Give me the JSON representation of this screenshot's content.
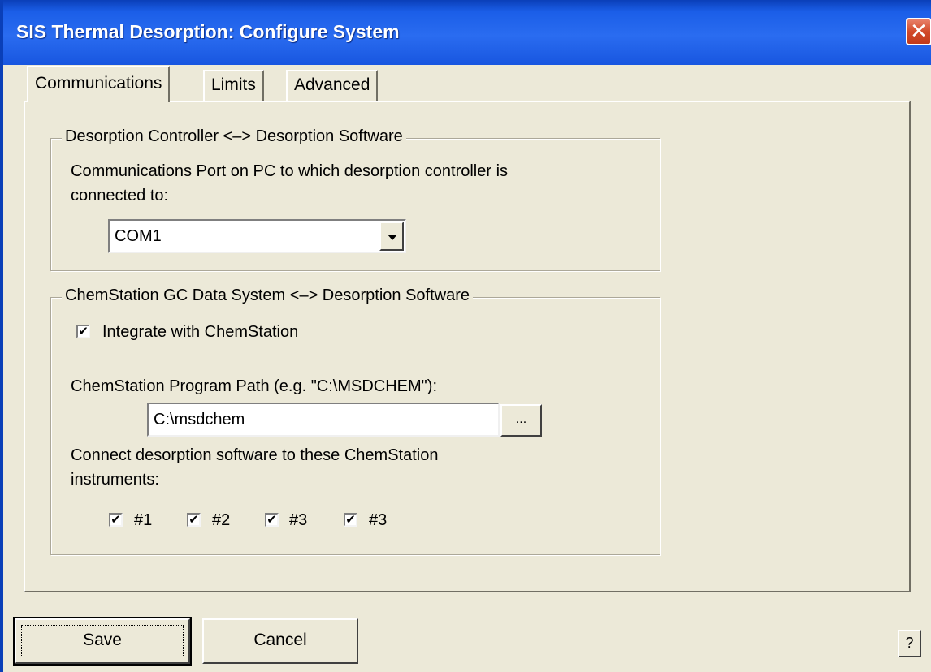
{
  "window": {
    "title": "SIS Thermal Desorption: Configure System",
    "close_glyph": "✕"
  },
  "tabs": [
    {
      "label": "Communications",
      "active": true
    },
    {
      "label": "Limits",
      "active": false
    },
    {
      "label": "Advanced",
      "active": false
    }
  ],
  "controller_group": {
    "legend": "Desorption Controller <–> Desorption Software",
    "port_label_line1": "Communications Port on PC to which desorption controller is",
    "port_label_line2": "connected to:",
    "port_value": "COM1"
  },
  "chemstation_group": {
    "legend": "ChemStation GC Data System <–> Desorption Software",
    "integrate_label": "Integrate with ChemStation",
    "integrate_checked": true,
    "path_label": "ChemStation Program Path (e.g. \"C:\\MSDCHEM\"):",
    "path_value": "C:\\msdchem",
    "browse_label": "...",
    "instruments_label_line1": "Connect desorption software to these ChemStation",
    "instruments_label_line2": "instruments:",
    "instruments": [
      {
        "label": "#1",
        "checked": true
      },
      {
        "label": "#2",
        "checked": true
      },
      {
        "label": "#3",
        "checked": true
      },
      {
        "label": "#3",
        "checked": true
      }
    ]
  },
  "footer": {
    "save_label": "Save",
    "cancel_label": "Cancel",
    "help_label": "?"
  },
  "check_glyph": "✔"
}
